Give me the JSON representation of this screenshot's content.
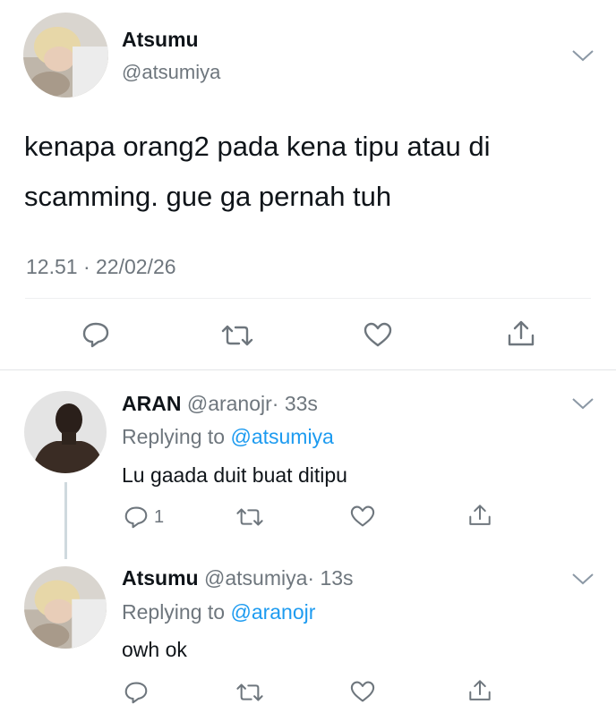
{
  "main_tweet": {
    "display_name": "Atsumu",
    "handle": "@atsumiya",
    "text_line1": "kenapa orang2 pada kena tipu atau di",
    "text_line2": "scamming. gue ga pernah tuh",
    "timestamp": "12.51 · 22/02/26",
    "icons": [
      "reply-icon",
      "retweet-icon",
      "like-icon",
      "share-icon"
    ]
  },
  "replies": [
    {
      "display_name": "ARAN",
      "handle": "@aranojr",
      "time": "· 33s",
      "replying_prefix": "Replying to",
      "replying_to": "@atsumiya",
      "text": "Lu gaada duit buat ditipu",
      "reply_count": "1"
    },
    {
      "display_name": "Atsumu",
      "handle": "@atsumiya",
      "time": "· 13s",
      "replying_prefix": "Replying to",
      "replying_to": "@aranojr",
      "text": "owh ok",
      "reply_count": ""
    }
  ],
  "colors": {
    "text": "#0f1419",
    "secondary": "#6e767d",
    "link": "#1d9bf0",
    "divider": "#e6e6e6"
  }
}
